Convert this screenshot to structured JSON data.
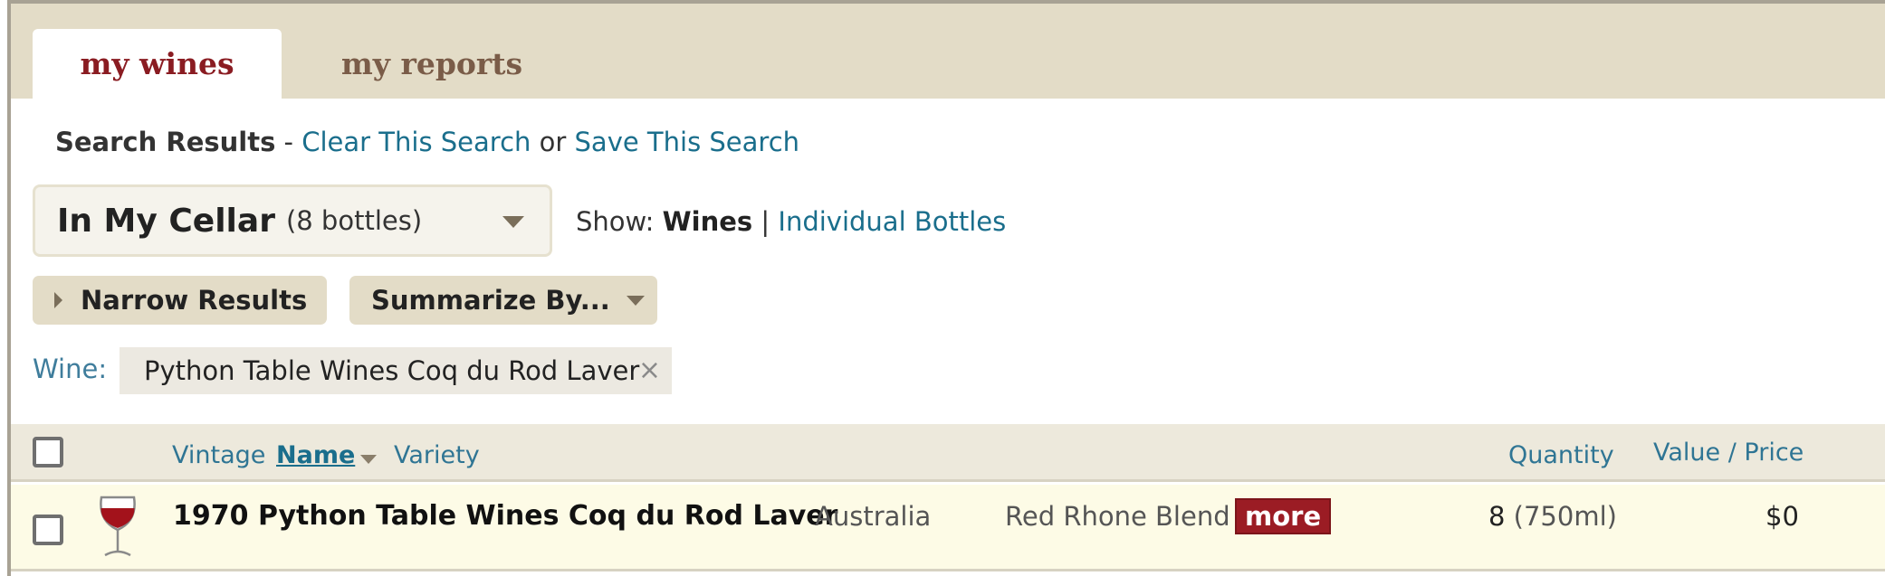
{
  "tabs": [
    {
      "label": "my wines",
      "active": true
    },
    {
      "label": "my reports",
      "active": false
    }
  ],
  "search": {
    "title": "Search Results",
    "dash": " - ",
    "clear_link": "Clear This Search",
    "or": " or ",
    "save_link": "Save This Search"
  },
  "cellar": {
    "label": "In My Cellar",
    "count": "(8 bottles)"
  },
  "show": {
    "label": "Show: ",
    "current": "Wines",
    "separator": " | ",
    "alt_link": "Individual Bottles"
  },
  "buttons": {
    "narrow": "Narrow Results",
    "summarize": "Summarize By..."
  },
  "filter": {
    "label": "Wine:",
    "value": "Python Table Wines Coq du Rod Laver",
    "remove_glyph": "×"
  },
  "table": {
    "columns": {
      "vintage": "Vintage",
      "name": "Name",
      "variety": "Variety",
      "quantity": "Quantity",
      "value_price": "Value / Price"
    },
    "rows": [
      {
        "name": "1970 Python Table Wines Coq du Rod Laver",
        "region": "Australia",
        "variety": "Red Rhone Blend",
        "more": "more",
        "quantity": "8",
        "size": "(750ml)",
        "value": "$0",
        "wine_type_icon": "red-wine-glass-icon"
      }
    ]
  },
  "colors": {
    "tab_bg": "#e3dcc7",
    "active_tab_text": "#8a1c22",
    "link": "#1a6e8c",
    "badge": "#9b1c24",
    "row_highlight": "#fdfbe6"
  }
}
